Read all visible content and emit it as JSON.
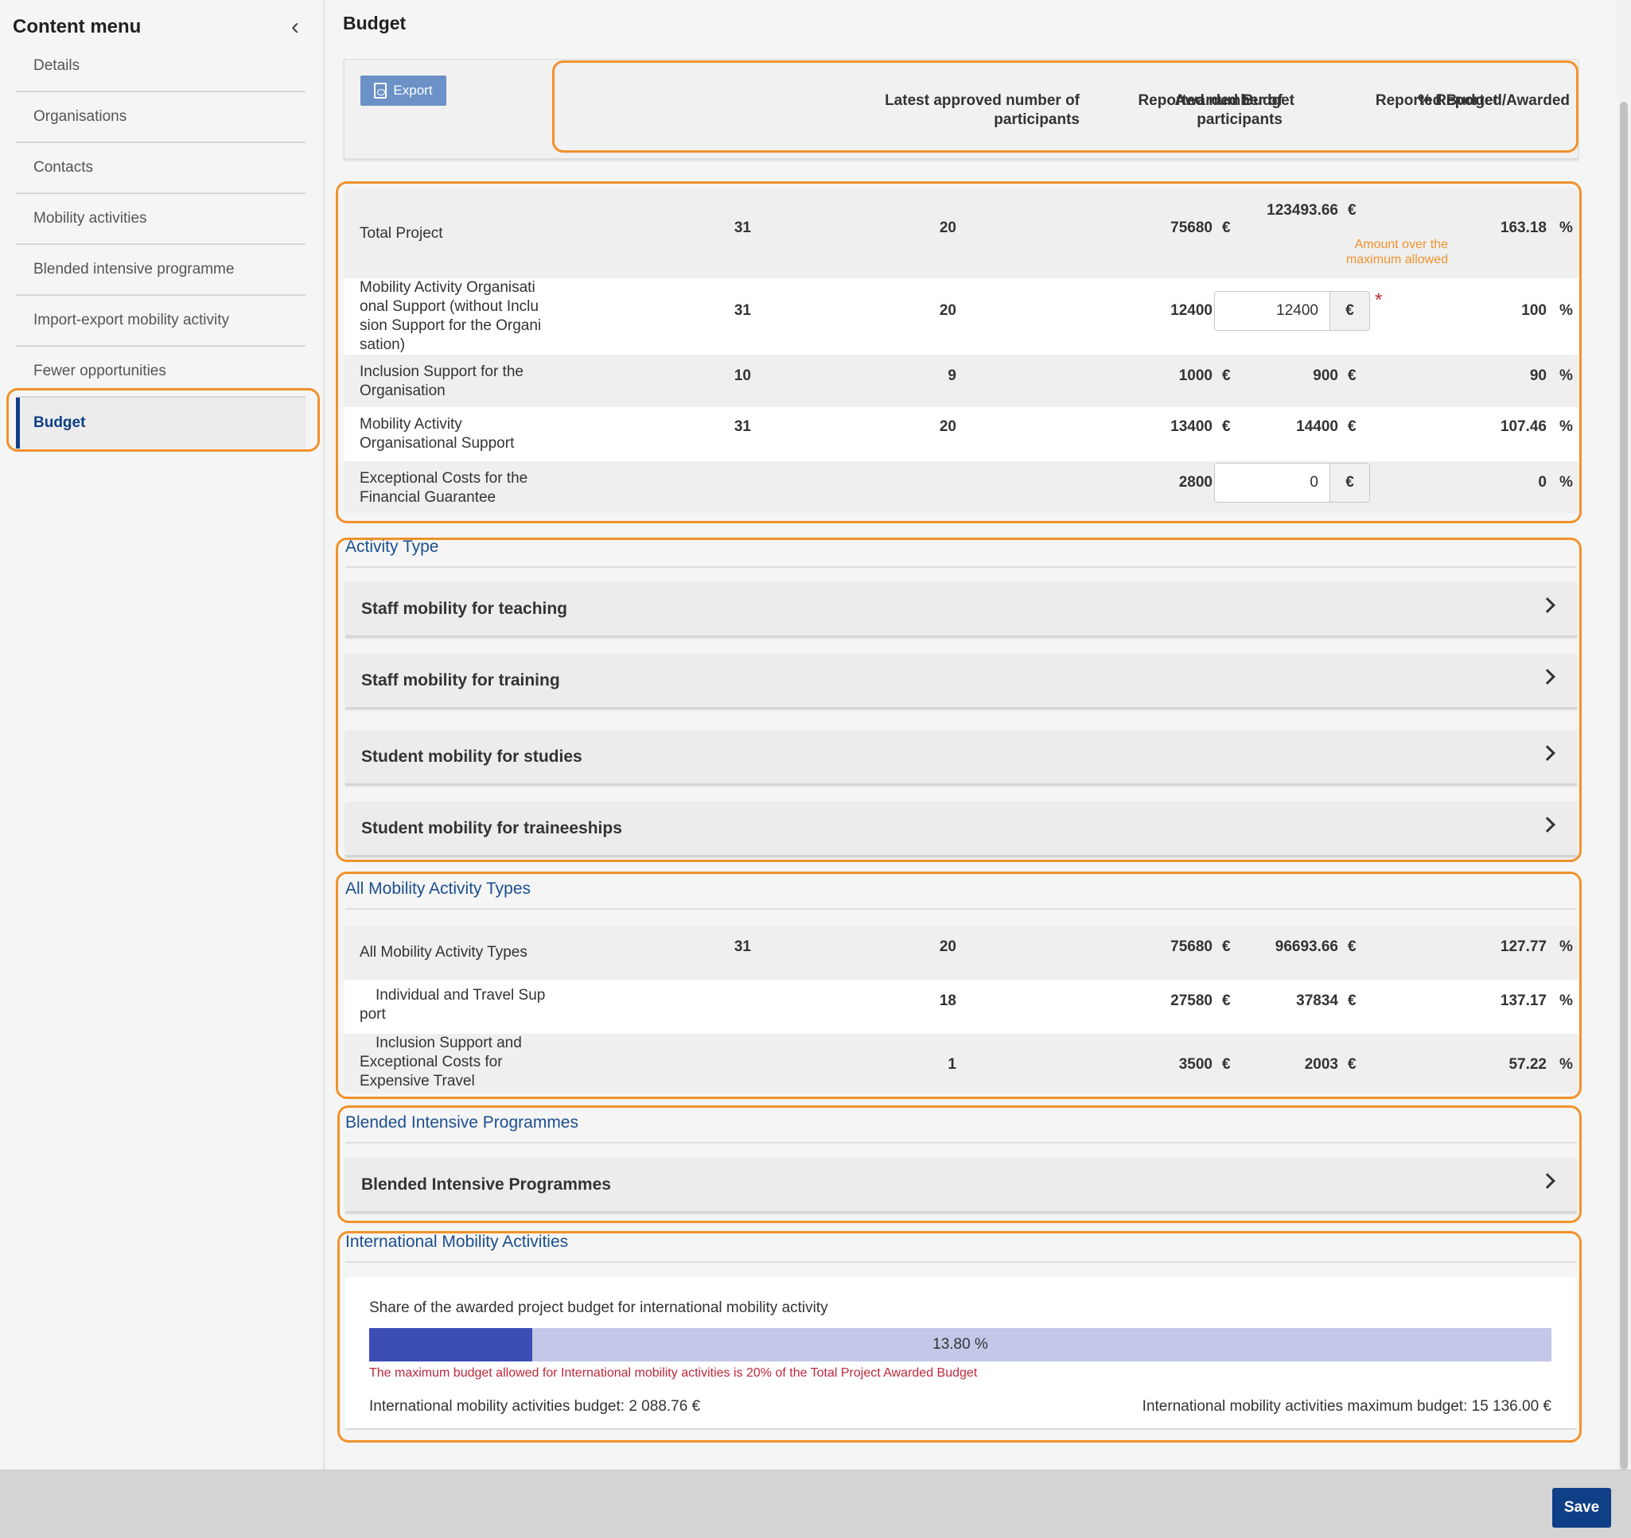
{
  "sidebar": {
    "title": "Content menu",
    "items": [
      {
        "label": "Details"
      },
      {
        "label": "Organisations"
      },
      {
        "label": "Contacts"
      },
      {
        "label": "Mobility activities"
      },
      {
        "label": "Blended intensive programme"
      },
      {
        "label": "Import-export mobility activity"
      },
      {
        "label": "Fewer opportunities"
      },
      {
        "label": "Budget"
      }
    ]
  },
  "page": {
    "title": "Budget",
    "export_label": "Export"
  },
  "columns": {
    "approved_1": "Latest approved number of",
    "approved_2": "participants",
    "reported_1": "Reported number of",
    "reported_2": "participants",
    "awarded": "Awarded Budget",
    "reported_budget": "Reported Budget",
    "pct": "% Reported/Awarded"
  },
  "units": {
    "euro": "€",
    "percent": "%"
  },
  "budget_rows": [
    {
      "label": "Total Project",
      "approved": "31",
      "reported": "20",
      "awarded": "75680",
      "reported_budget": "123493.66",
      "pct": "163.18",
      "warning_1": "Amount over the",
      "warning_2": "maximum allowed"
    },
    {
      "label_1": "Mobility Activity Organisati",
      "label_2": "onal Support (without Inclu",
      "label_3": "sion Support for the Organi",
      "label_4": "sation)",
      "approved": "31",
      "reported": "20",
      "awarded": "12400",
      "reported_budget": "12400",
      "pct": "100",
      "required": "*"
    },
    {
      "label_1": "Inclusion Support for the",
      "label_2": "Organisation",
      "approved": "10",
      "reported": "9",
      "awarded": "1000",
      "reported_budget": "900",
      "pct": "90"
    },
    {
      "label_1": "Mobility Activity",
      "label_2": "Organisational Support",
      "approved": "31",
      "reported": "20",
      "awarded": "13400",
      "reported_budget": "14400",
      "pct": "107.46"
    },
    {
      "label_1": "Exceptional Costs for the",
      "label_2": "Financial Guarantee",
      "awarded": "2800",
      "reported_budget": "0",
      "pct": "0"
    }
  ],
  "activity_type": {
    "title": "Activity Type",
    "items": [
      {
        "label": "Staff mobility for teaching"
      },
      {
        "label": "Staff mobility for training"
      },
      {
        "label": "Student mobility for studies"
      },
      {
        "label": "Student mobility for traineeships"
      }
    ]
  },
  "all_mobility": {
    "title": "All Mobility Activity Types",
    "rows": [
      {
        "label": "All Mobility Activity Types",
        "approved": "31",
        "reported": "20",
        "awarded": "75680",
        "reported_budget": "96693.66",
        "pct": "127.77"
      },
      {
        "label_1": "Individual and Travel Sup",
        "label_2": "port",
        "reported": "18",
        "awarded": "27580",
        "reported_budget": "37834",
        "pct": "137.17"
      },
      {
        "label_1": "Inclusion Support and",
        "label_2": "Exceptional Costs for",
        "label_3": "Expensive Travel",
        "reported": "1",
        "awarded": "3500",
        "reported_budget": "2003",
        "pct": "57.22"
      }
    ]
  },
  "blended": {
    "title": "Blended Intensive Programmes",
    "item": "Blended Intensive Programmes"
  },
  "international": {
    "title": "International Mobility Activities",
    "question": "Share of the awarded project budget for international mobility activity",
    "share_percent": 13.8,
    "share_label": "13.80 %",
    "warning": "The maximum budget allowed for International mobility activities is 20% of the Total Project Awarded Budget",
    "budget_text": "International mobility activities budget: 2 088.76 €",
    "max_budget_text": "International mobility activities maximum budget: 15 136.00 €"
  },
  "footer": {
    "save_label": "Save"
  }
}
